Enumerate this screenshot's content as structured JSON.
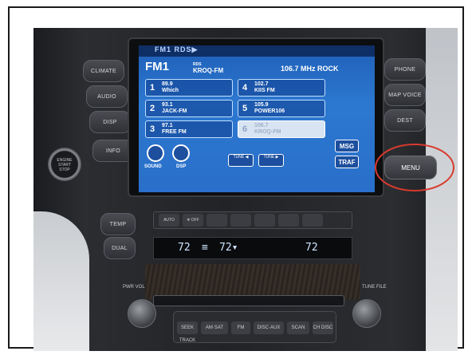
{
  "left_buttons": {
    "climate": "CLIMATE",
    "audio": "AUDIO",
    "disp": "DISP",
    "info": "INFO"
  },
  "right_buttons": {
    "phone": "PHONE",
    "map_voice": "MAP VOICE",
    "dest": "DEST",
    "menu": "MENU"
  },
  "screen": {
    "top_bar": "FM1 RDS▶",
    "band": "FM1",
    "current_station_tag": "RDS",
    "current_station": "KROQ-FM",
    "current_freq": "106.7 MHz ROCK",
    "presets": [
      {
        "num": "1",
        "freq": "89.9",
        "name": "Which"
      },
      {
        "num": "2",
        "freq": "93.1",
        "name": "JACK-FM"
      },
      {
        "num": "3",
        "freq": "97.1",
        "name": "FREE FM"
      },
      {
        "num": "4",
        "freq": "102.7",
        "name": "KIIS FM"
      },
      {
        "num": "5",
        "freq": "105.9",
        "name": "POWER106"
      },
      {
        "num": "6",
        "freq": "106.7",
        "name": "KROQ-FM"
      }
    ],
    "sound_label": "SOUND",
    "dsp_label": "DSP",
    "seek_down": "TUNE ◀",
    "seek_up": "TUNE ▶",
    "msg": "MSG",
    "traf": "TRAF"
  },
  "climate": {
    "auto": "AUTO",
    "off": "❄ OFF",
    "temp_label": "TEMP",
    "dual_label": "DUAL",
    "left_temp": "72",
    "mode_icon": "≡",
    "center_temp": "72▾",
    "right_temp": "72"
  },
  "start_button": "ENGINE START STOP",
  "audio_controls": {
    "seek_track": "SEEK TRACK",
    "am_sat": "AM·SAT",
    "fm": "FM",
    "disc_aux": "DISC·AUX",
    "scan": "SCAN",
    "ch_disc": "CH DISC",
    "pwr_vol": "PWR VOL",
    "tune_file": "TUNE FILE"
  },
  "colors": {
    "screen_blue": "#2c78d0",
    "highlight_ring": "#d83a2e"
  }
}
